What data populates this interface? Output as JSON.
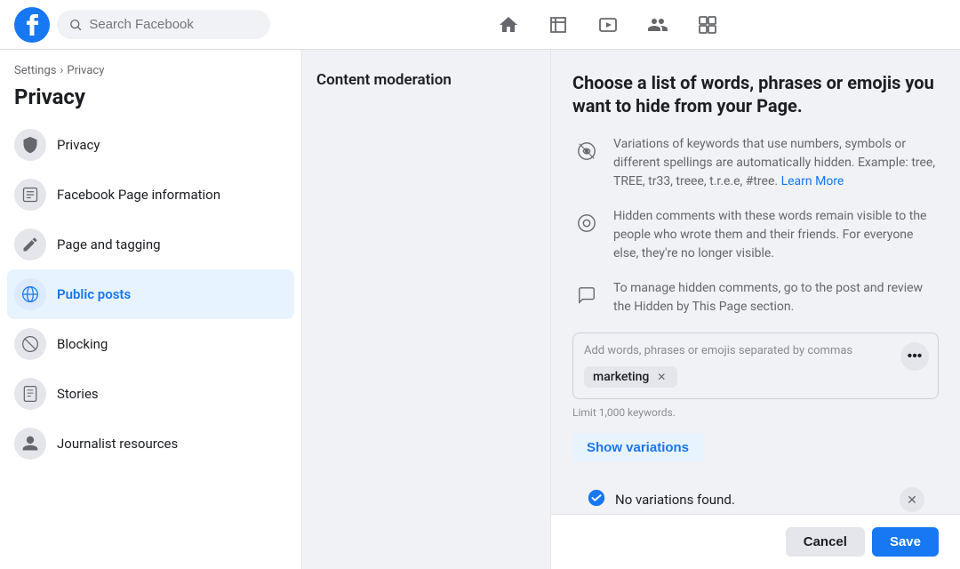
{
  "topnav": {
    "search_placeholder": "Search Facebook",
    "nav_icons": [
      "home",
      "flag",
      "play",
      "group",
      "grid"
    ]
  },
  "sidebar": {
    "breadcrumb_settings": "Settings",
    "breadcrumb_sep": "›",
    "breadcrumb_privacy": "Privacy",
    "title": "Privacy",
    "items": [
      {
        "id": "privacy",
        "label": "Privacy",
        "icon": "🔒"
      },
      {
        "id": "page-info",
        "label": "Facebook Page information",
        "icon": "🏢"
      },
      {
        "id": "page-tagging",
        "label": "Page and tagging",
        "icon": "✏️"
      },
      {
        "id": "public-posts",
        "label": "Public posts",
        "icon": "🌐",
        "active": true
      },
      {
        "id": "blocking",
        "label": "Blocking",
        "icon": "🚫"
      },
      {
        "id": "stories",
        "label": "Stories",
        "icon": "📖"
      },
      {
        "id": "journalist",
        "label": "Journalist resources",
        "icon": "👤"
      }
    ]
  },
  "middle": {
    "section_title": "Content moderation"
  },
  "panel": {
    "heading": "Choose a list of words, phrases or emojis you want to hide from your Page.",
    "info_rows": [
      {
        "id": "variations",
        "text": "Variations of keywords that use numbers, symbols or different spellings are automatically hidden. Example: tree, TREE, tr33, treee, t.r.e.e, #tree.",
        "link_text": "Learn More",
        "link_url": "#"
      },
      {
        "id": "hidden-comments",
        "text": "Hidden comments with these words remain visible to the people who wrote them and their friends. For everyone else, they're no longer visible."
      },
      {
        "id": "manage-hidden",
        "text": "To manage hidden comments, go to the post and review the Hidden by This Page section."
      }
    ],
    "keyword_input": {
      "placeholder": "Add words, phrases or emojis separated by commas",
      "tags": [
        {
          "label": "marketing"
        }
      ],
      "limit_text": "Limit 1,000 keywords."
    },
    "show_variations_btn": "Show variations",
    "variations_result": {
      "text": "No variations found."
    },
    "cancel_btn": "Cancel",
    "save_btn": "Save"
  }
}
